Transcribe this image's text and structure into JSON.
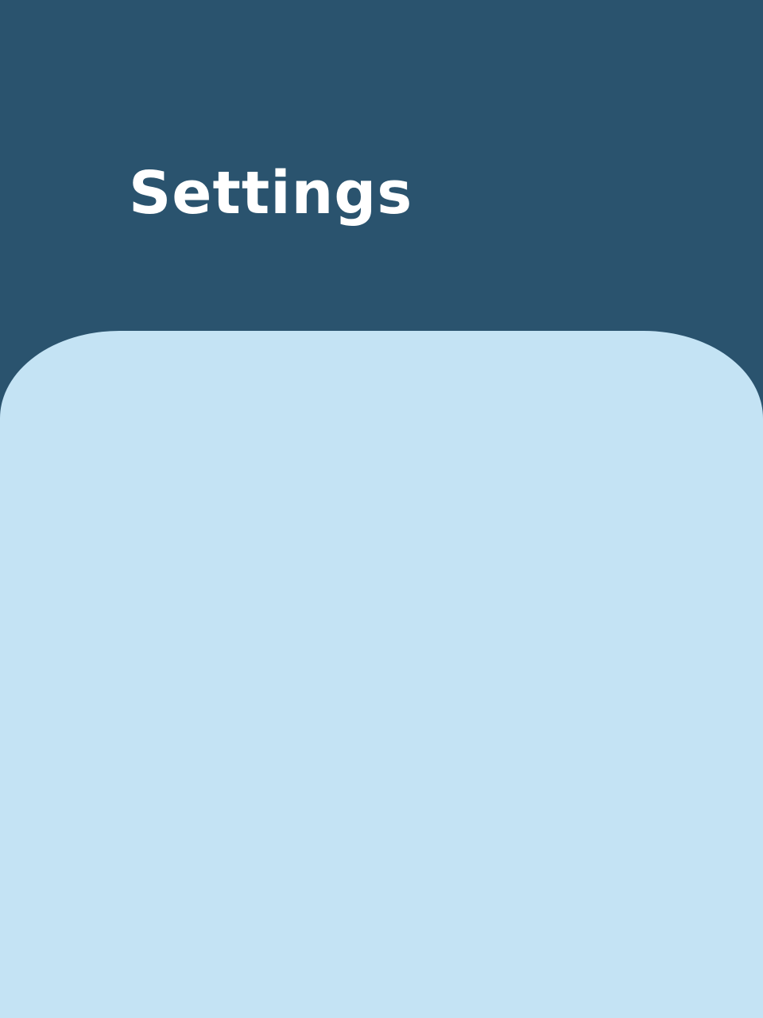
{
  "header": {
    "title": "Settings"
  },
  "colors": {
    "header_background": "#2A536E",
    "panel_background": "#C4E3F4",
    "title_text": "#FFFFFF"
  }
}
